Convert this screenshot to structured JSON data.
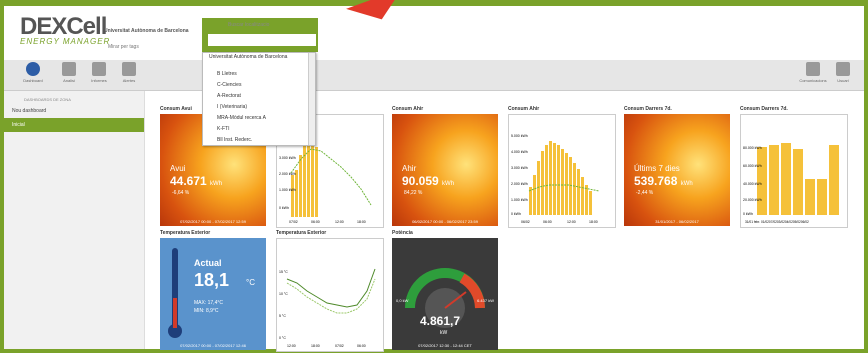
{
  "header": {
    "logo_main": "DEXCell",
    "logo_sub": "ENERGY MANAGER",
    "org": "Universitat Autònoma de Barcelona",
    "role": "Mirar per tags",
    "search_label": "Buscar localitzacio",
    "search_value": ""
  },
  "dropdown": {
    "items": [
      "Universitat Autònoma de Barcelona",
      "B Lletres",
      "C-Ciencies",
      "A-Rectorat",
      "I (Veterinaria)",
      "MRA-Mòdul recerca A",
      "K-FTI",
      "Bll Inst. Rederc."
    ]
  },
  "toolbar": {
    "items": [
      "Dashboard",
      "Analisi",
      "Informes",
      "Alertes"
    ],
    "right": [
      "Comunicacions",
      "Usuari"
    ]
  },
  "sidebar": {
    "title": "DASHBOARDS DE ZONA",
    "items": [
      "Nou dashboard",
      "Inicial"
    ]
  },
  "cards": {
    "avui": {
      "title": "Consum Avui",
      "label": "Avui",
      "value": "44.671",
      "unit": "kWh",
      "pct": "-6,64 %",
      "foot": "07/02/2017 00:00 - 07/02/2017 12:59"
    },
    "ahir": {
      "title": "Consum Ahir",
      "label": "Ahir",
      "value": "90.059",
      "unit": "kWh",
      "pct": "84,22 %",
      "foot": "06/02/2017 00:00 - 06/02/2017 23:59"
    },
    "ahir_chart": {
      "title": "Consum Ahir",
      "yticks": [
        "5.000 kWh",
        "4.000 kWh",
        "3.000 kWh",
        "2.000 kWh",
        "1.000 kWh",
        "0 kWh"
      ],
      "xticks": [
        "06/02",
        "06:00",
        "12:00",
        "18:00"
      ]
    },
    "avui_chart": {
      "yticks": [
        "4.000 kWh",
        "3.000 kWh",
        "2.000 kWh",
        "1.000 kWh",
        "0 kWh"
      ],
      "xticks": [
        "07/02",
        "06:00",
        "12:00",
        "18:00"
      ]
    },
    "darrers": {
      "title": "Consum Darrers 7d.",
      "label": "Últims 7 dies",
      "value": "539.768",
      "unit": "kWh",
      "pct": "-2,44 %",
      "foot": "31/01/2017 - 06/02/2017"
    },
    "darrers_chart": {
      "title": "Consum Darrers 7d.",
      "yticks": [
        "80.000 kWh",
        "60.000 kWh",
        "40.000 kWh",
        "20.000 kWh",
        "0 kWh"
      ],
      "xticks": "31/01 febr. 01/0207/0203/0204/0205/0206/02"
    },
    "temp": {
      "title": "Temperatura Exterior",
      "label": "Actual",
      "value": "18,1",
      "unit": "°C",
      "max": "MAX: 17,4°C",
      "min": "MIN: 8,9°C",
      "foot": "07/02/2017 00:00 - 07/02/2017 12:46"
    },
    "temp_chart": {
      "title": "Temperatura Exterior",
      "yticks": [
        "15 °C",
        "10 °C",
        "5 °C",
        "0 °C"
      ],
      "xticks": [
        "12:00",
        "18:00",
        "07/02",
        "06:00"
      ]
    },
    "potencia": {
      "title": "Potència",
      "value": "4.861,7",
      "unit": "kW",
      "left": "0,0 kW",
      "right": "6.437 kW",
      "foot": "07/02/2017 12:30 - 12:44 CET"
    }
  },
  "colors": {
    "accent": "#7aa22a",
    "bar": "#f5c13a",
    "line": "#6fb53a"
  }
}
